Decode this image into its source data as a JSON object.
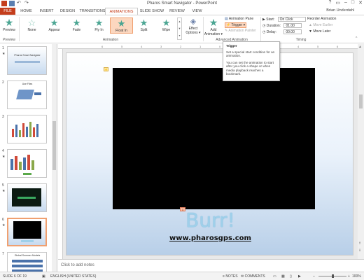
{
  "window": {
    "title": "Pharos Smart Navigator - PowerPoint",
    "user": "Brian Underdahl",
    "controls": [
      "?",
      "▭",
      "–",
      "□",
      "✕"
    ]
  },
  "tabs": [
    "FILE",
    "HOME",
    "INSERT",
    "DESIGN",
    "TRANSITIONS",
    "ANIMATIONS",
    "SLIDE SHOW",
    "REVIEW",
    "VIEW"
  ],
  "active_tab": "ANIMATIONS",
  "ribbon": {
    "preview": {
      "label": "Preview",
      "group": "Preview"
    },
    "animations": {
      "items": [
        "None",
        "Appear",
        "Fade",
        "Fly In",
        "Float In",
        "Split",
        "Wipe"
      ],
      "selected": "Float In",
      "group": "Animation"
    },
    "effect_options": [
      "Effect",
      "Options ▾"
    ],
    "add_animation": [
      "Add",
      "Animation ▾"
    ],
    "advanced": {
      "animation_pane": "Animation Pane",
      "trigger": "Trigger ▾",
      "animation_painter": "Animation Painter",
      "group": "Advanced Animation"
    },
    "timing": {
      "start_label": "Start:",
      "start_value": "On Click",
      "duration_label": "Duration:",
      "duration_value": "01.00",
      "delay_label": "Delay:",
      "delay_value": "00.00",
      "reorder": "Reorder Animation",
      "move_earlier": "▲ Move Earlier",
      "move_later": "▼ Move Later",
      "group": "Timing"
    }
  },
  "tooltip": {
    "title": "Trigger",
    "para1": "Set a special start condition for an animation.",
    "para2": "You can set the animation to start after you click a shape or when media playback reaches a bookmark."
  },
  "thumbnails": [
    {
      "num": "1",
      "title": "Pharos Smart Navigator"
    },
    {
      "num": "2",
      "title": "Use Files"
    },
    {
      "num": "3",
      "title": ""
    },
    {
      "num": "4",
      "title": ""
    },
    {
      "num": "5",
      "title": ""
    },
    {
      "num": "6",
      "title": ""
    },
    {
      "num": "7",
      "title": "Global Summer Models"
    }
  ],
  "slide": {
    "heading": "Burr!",
    "url": "www.pharosgps.com",
    "ruler_ticks": [
      "6",
      "5",
      "4",
      "3",
      "2",
      "1",
      "0",
      "1",
      "2",
      "3",
      "4",
      "5",
      "6"
    ]
  },
  "notes_placeholder": "Click to add notes",
  "status": {
    "slide": "SLIDE 6 OF 19",
    "language": "ENGLISH (UNITED STATES)",
    "notes": "NOTES",
    "comments": "COMMENTS",
    "zoom": "100%"
  },
  "colors": {
    "file_tab": "#c43e1c",
    "accent": "#c43e1c",
    "selection": "#fcd7bf",
    "star": "#4aa592"
  }
}
